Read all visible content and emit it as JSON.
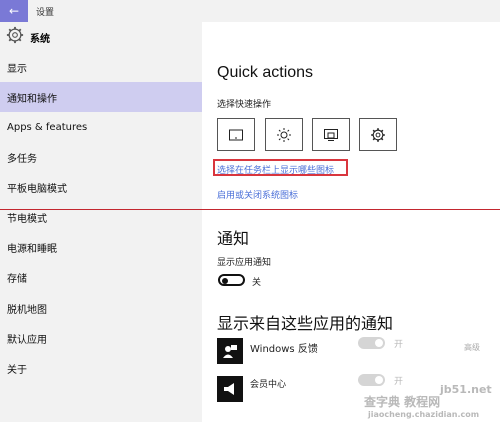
{
  "window": {
    "title": "设置"
  },
  "sidebar": {
    "header": "系统",
    "items": [
      {
        "label": "显示"
      },
      {
        "label": "通知和操作",
        "active": true
      },
      {
        "label": "Apps & features"
      },
      {
        "label": "多任务"
      },
      {
        "label": "平板电脑模式"
      },
      {
        "label": "节电模式"
      },
      {
        "label": "电源和睡眠"
      },
      {
        "label": "存储"
      },
      {
        "label": "脱机地图"
      },
      {
        "label": "默认应用"
      },
      {
        "label": "关于"
      }
    ]
  },
  "main": {
    "quick_actions_title": "Quick actions",
    "quick_actions_subtitle": "选择快速操作",
    "tiles": [
      "tablet-mode-icon",
      "brightness-icon",
      "project-icon",
      "settings-icon"
    ],
    "link_taskbar_icons": "选择在任务栏上显示哪些图标",
    "link_system_icons": "启用或关闭系统图标",
    "notifications_title": "通知",
    "show_app_notifications": "显示应用通知",
    "toggle_state": "关",
    "from_apps_title": "显示来自这些应用的通知",
    "apps": [
      {
        "name": "Windows 反馈",
        "state": "开",
        "priority": "高级"
      },
      {
        "name": "会员中心",
        "state": "开"
      }
    ]
  },
  "watermark": {
    "line1": "查字典 教程网",
    "line2": "jiaocheng.chazidian.com",
    "site": "jb51.net"
  },
  "colors": {
    "accent": "#7a79d6",
    "active_nav": "#cfcdf0",
    "link": "#4a6fd8",
    "highlight": "#d9363e"
  }
}
